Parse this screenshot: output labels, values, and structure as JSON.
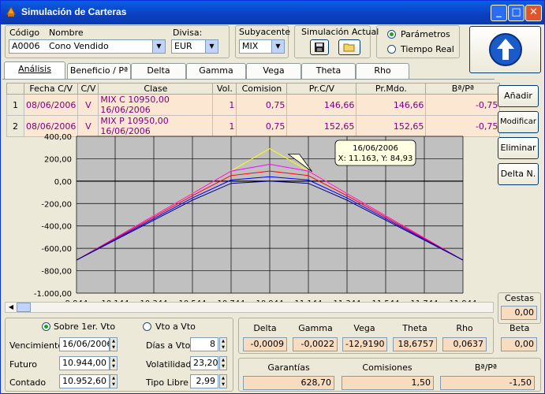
{
  "window": {
    "title": "Simulación de Carteras"
  },
  "header": {
    "codigo_label": "Código",
    "codigo_value": "A0006",
    "nombre_label": "Nombre",
    "nombre_value": "Cono Vendido",
    "divisa_label": "Divisa:",
    "divisa_value": "EUR",
    "subyacente_label": "Subyacente",
    "subyacente_value": "MIX",
    "simulacion_label": "Simulación Actual",
    "radio_parametros": "Parámetros",
    "radio_tiempo": "Tiempo Real"
  },
  "tabs": [
    "Análisis",
    "Beneficio / Pª",
    "Delta",
    "Gamma",
    "Vega",
    "Theta",
    "Rho"
  ],
  "grid": {
    "columns": [
      "Fecha C/V",
      "C/V",
      "Clase",
      "Vol.",
      "Comision",
      "Pr.C/V",
      "Pr.Mdo.",
      "Bª/Pª"
    ],
    "rows": [
      {
        "n": "1",
        "fecha": "08/06/2006",
        "cv": "V",
        "clase": "MIX C 10950,00 16/06/2006",
        "vol": "1",
        "comision": "0,75",
        "prcv": "146,66",
        "prmdo": "146,66",
        "bp": "-0,75"
      },
      {
        "n": "2",
        "fecha": "08/06/2006",
        "cv": "V",
        "clase": "MIX P 10950,00 16/06/2006",
        "vol": "1",
        "comision": "0,75",
        "prcv": "152,65",
        "prmdo": "152,65",
        "bp": "-0,75"
      }
    ]
  },
  "side_buttons": {
    "anadir": "Añadir",
    "modificar": "Modificar",
    "eliminar": "Eliminar",
    "delta": "Delta N."
  },
  "chart_data": {
    "type": "line",
    "yticks": [
      "400,00",
      "200,00",
      "0,00",
      "-200,00",
      "-400,00",
      "-600,00",
      "-800,00",
      "-1.000,00"
    ],
    "xticks": [
      "9.944",
      "10.144",
      "10.344",
      "10.544",
      "10.744",
      "10.944",
      "11.144",
      "11.344",
      "11.544",
      "11.744",
      "11.944"
    ],
    "xlim": [
      9944,
      11944
    ],
    "ylim": [
      -1000,
      400
    ],
    "series": [
      {
        "color": "#ffff00",
        "points": [
          [
            9944,
            -705
          ],
          [
            10944,
            290
          ],
          [
            11944,
            -705
          ]
        ]
      },
      {
        "color": "#ff00ff",
        "points": [
          [
            9944,
            -705
          ],
          [
            10544,
            -110
          ],
          [
            10744,
            90
          ],
          [
            10944,
            150
          ],
          [
            11144,
            90
          ],
          [
            11344,
            -110
          ],
          [
            11944,
            -705
          ]
        ]
      },
      {
        "color": "#ff0000",
        "points": [
          [
            9944,
            -705
          ],
          [
            10544,
            -130
          ],
          [
            10744,
            50
          ],
          [
            10944,
            90
          ],
          [
            11144,
            50
          ],
          [
            11344,
            -130
          ],
          [
            11944,
            -705
          ]
        ]
      },
      {
        "color": "#0000ff",
        "points": [
          [
            9944,
            -705
          ],
          [
            10544,
            -150
          ],
          [
            10744,
            10
          ],
          [
            10944,
            40
          ],
          [
            11144,
            10
          ],
          [
            11344,
            -150
          ],
          [
            11944,
            -705
          ]
        ]
      },
      {
        "color": "#000080",
        "points": [
          [
            9944,
            -705
          ],
          [
            10544,
            -170
          ],
          [
            10744,
            -20
          ],
          [
            10944,
            0
          ],
          [
            11144,
            -20
          ],
          [
            11344,
            -170
          ],
          [
            11944,
            -705
          ]
        ]
      }
    ],
    "tooltip": {
      "line1": "16/06/2006",
      "line2": "X: 11.163, Y: 84,93"
    }
  },
  "cestas": {
    "label": "Cestas",
    "value": "0,00",
    "beta_label": "Beta",
    "beta_value": "0,00"
  },
  "params": {
    "radio_sobre": "Sobre 1er. Vto",
    "radio_vto": "Vto a Vto",
    "vencimiento_label": "Vencimiento",
    "vencimiento_value": "16/06/2006",
    "futuro_label": "Futuro",
    "futuro_value": "10.944,00",
    "contado_label": "Contado",
    "contado_value": "10.952,60",
    "dias_label": "Días a Vto.",
    "dias_value": "8",
    "vol_label": "Volatilidad",
    "vol_value": "23,20",
    "tipo_label": "Tipo Libre",
    "tipo_value": "2,99"
  },
  "greeks": {
    "labels": [
      "Delta",
      "Gamma",
      "Vega",
      "Theta",
      "Rho"
    ],
    "values": [
      "-0,0009",
      "-0,0022",
      "-12,9190",
      "18,6757",
      "0,0637"
    ]
  },
  "totals": {
    "labels": [
      "Garantías",
      "Comisiones",
      "Bª/Pª"
    ],
    "values": [
      "628,70",
      "1,50",
      "-1,50"
    ]
  }
}
